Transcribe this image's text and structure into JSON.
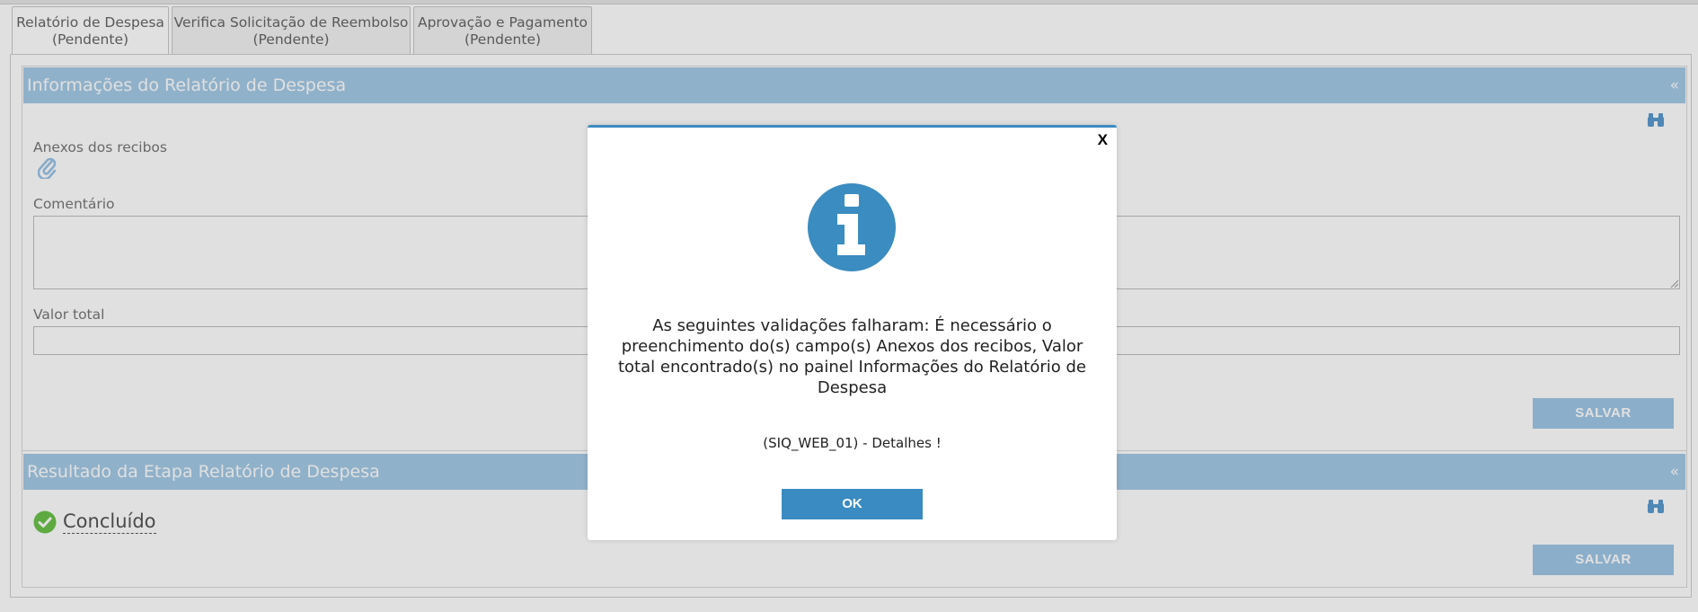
{
  "tabs": [
    {
      "line1": "Relatório de Despesa",
      "line2": "(Pendente)"
    },
    {
      "line1": "Verifica Solicitação de Reembolso",
      "line2": "(Pendente)"
    },
    {
      "line1": "Aprovação e Pagamento",
      "line2": "(Pendente)"
    }
  ],
  "panel_info": {
    "title": "Informações do Relatório de Despesa",
    "collapse_glyph": "«",
    "attachments_label": "Anexos dos recibos",
    "comment_label": "Comentário",
    "comment_value": "",
    "total_label": "Valor total",
    "total_value": "",
    "save_label": "SALVAR"
  },
  "panel_result": {
    "title": "Resultado da Etapa Relatório de Despesa",
    "collapse_glyph": "«",
    "status_text": "Concluído",
    "save_label": "SALVAR"
  },
  "modal": {
    "close_label": "X",
    "message": "As seguintes validações falharam: É necessário o preenchimento do(s) campo(s) Anexos dos recibos, Valor total encontrado(s) no painel Informações do Relatório de Despesa",
    "code_text": "(SIQ_WEB_01) - Detalhes !",
    "ok_label": "OK"
  },
  "colors": {
    "panel_header": "#a4cae6",
    "modal_accent": "#3b8cc0",
    "ok_button": "#3a8bc2",
    "save_button": "#9fc7e6",
    "success": "#6cc24a"
  },
  "icons": {
    "attachments": "paperclip-icon",
    "search": "binoculars-icon",
    "info": "info-circle-icon",
    "status": "check-circle-icon"
  }
}
